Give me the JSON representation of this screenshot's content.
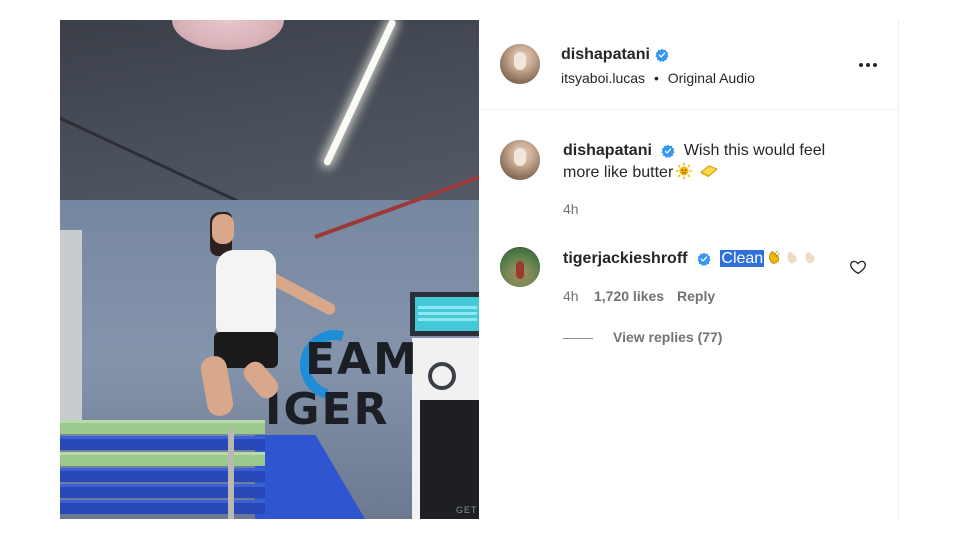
{
  "post": {
    "username": "dishapatani",
    "verified": true,
    "audio_author": "itsyaboi.lucas",
    "audio_title": "Original Audio",
    "separator": "•"
  },
  "media": {
    "wall_text_line1": "EAM",
    "wall_text_line2": "IGER",
    "corner_text": "GET"
  },
  "caption": {
    "username": "dishapatani",
    "text_line1": "Wish this would feel",
    "text_line2": "more like butter",
    "emojis": [
      "sun-emoji",
      "butter-emoji"
    ],
    "time": "4h"
  },
  "comments": [
    {
      "username": "tigerjackieshroff",
      "verified": true,
      "text": "Clean",
      "text_selected": true,
      "emojis": [
        "clap-emoji",
        "clap-emoji-faded",
        "clap-emoji-faded"
      ],
      "time": "4h",
      "likes": "1,720 likes",
      "reply_label": "Reply",
      "view_replies_label": "View replies (77)"
    }
  ],
  "colors": {
    "verified_blue": "#3897f0",
    "selection_blue": "#2e6fd8",
    "secondary_text": "#737373",
    "primary_text": "#262626"
  }
}
